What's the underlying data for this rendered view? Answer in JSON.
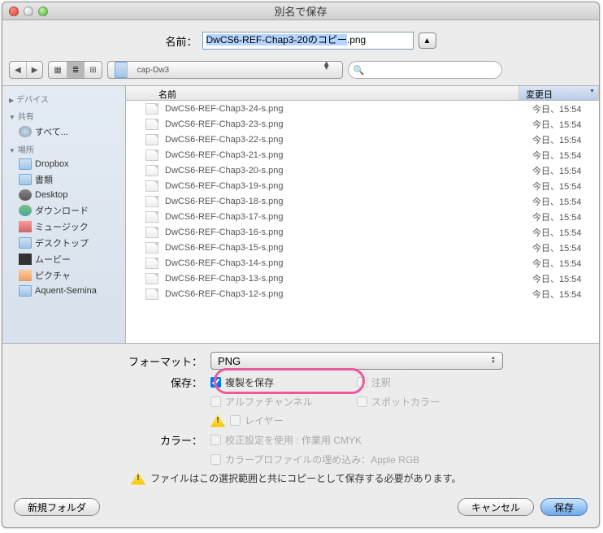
{
  "window": {
    "title": "別名で保存"
  },
  "name_row": {
    "label": "名前：",
    "value_selected": "DwCS6-REF-Chap3-20のコピー",
    "value_ext": ".png"
  },
  "toolbar": {
    "folder": "cap-Dw3",
    "search_placeholder": ""
  },
  "sidebar": {
    "groups": [
      {
        "label": "デバイス",
        "open": false,
        "items": []
      },
      {
        "label": "共有",
        "open": true,
        "items": [
          {
            "label": "すべて...",
            "icon": "i-globe"
          }
        ]
      },
      {
        "label": "場所",
        "open": true,
        "items": [
          {
            "label": "Dropbox",
            "icon": "i-folder"
          },
          {
            "label": "書類",
            "icon": "i-folder"
          },
          {
            "label": "Desktop",
            "icon": "i-desktop"
          },
          {
            "label": "ダウンロード",
            "icon": "i-down"
          },
          {
            "label": "ミュージック",
            "icon": "i-music"
          },
          {
            "label": "デスクトップ",
            "icon": "i-folder"
          },
          {
            "label": "ムービー",
            "icon": "i-movie"
          },
          {
            "label": "ピクチャ",
            "icon": "i-pic"
          },
          {
            "label": "Aquent-Semina",
            "icon": "i-folder"
          }
        ]
      }
    ]
  },
  "columns": {
    "name": "名前",
    "date": "変更日"
  },
  "files": [
    {
      "name": "DwCS6-REF-Chap3-24-s.png",
      "date": "今日、15:54"
    },
    {
      "name": "DwCS6-REF-Chap3-23-s.png",
      "date": "今日、15:54"
    },
    {
      "name": "DwCS6-REF-Chap3-22-s.png",
      "date": "今日、15:54"
    },
    {
      "name": "DwCS6-REF-Chap3-21-s.png",
      "date": "今日、15:54"
    },
    {
      "name": "DwCS6-REF-Chap3-20-s.png",
      "date": "今日、15:54"
    },
    {
      "name": "DwCS6-REF-Chap3-19-s.png",
      "date": "今日、15:54"
    },
    {
      "name": "DwCS6-REF-Chap3-18-s.png",
      "date": "今日、15:54"
    },
    {
      "name": "DwCS6-REF-Chap3-17-s.png",
      "date": "今日、15:54"
    },
    {
      "name": "DwCS6-REF-Chap3-16-s.png",
      "date": "今日、15:54"
    },
    {
      "name": "DwCS6-REF-Chap3-15-s.png",
      "date": "今日、15:54"
    },
    {
      "name": "DwCS6-REF-Chap3-14-s.png",
      "date": "今日、15:54"
    },
    {
      "name": "DwCS6-REF-Chap3-13-s.png",
      "date": "今日、15:54"
    },
    {
      "name": "DwCS6-REF-Chap3-12-s.png",
      "date": "今日、15:54"
    }
  ],
  "options": {
    "format_label": "フォーマット：",
    "format_value": "PNG",
    "save_label": "保存：",
    "checks": {
      "copy": "複製を保存",
      "annot": "注釈",
      "alpha": "アルファチャンネル",
      "spot": "スポットカラー",
      "layers": "レイヤー"
    },
    "color_label": "カラー：",
    "color1": "校正設定を使用 : 作業用 CMYK",
    "color2": "カラープロファイルの埋め込み：Apple RGB",
    "warning": "ファイルはこの選択範囲と共にコピーとして保存する必要があります。"
  },
  "footer": {
    "new_folder": "新規フォルダ",
    "cancel": "キャンセル",
    "save": "保存"
  }
}
